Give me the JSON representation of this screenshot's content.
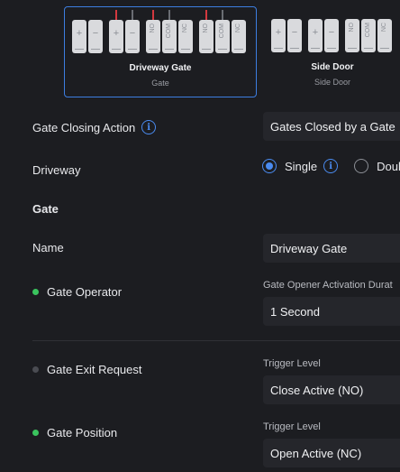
{
  "devices": [
    {
      "title": "Driveway Gate",
      "subtitle": "Gate",
      "selected": true,
      "terminals": [
        {
          "label": "+",
          "kind": "sym"
        },
        {
          "label": "−",
          "kind": "sym",
          "gap": true
        },
        {
          "label": "+",
          "kind": "sym",
          "wire": "red"
        },
        {
          "label": "−",
          "kind": "sym",
          "gap": true,
          "wire": "dark"
        },
        {
          "label": "NO",
          "kind": "text",
          "wire": "red"
        },
        {
          "label": "COM",
          "kind": "text",
          "wire": "dark"
        },
        {
          "label": "NC",
          "kind": "text",
          "gap": true
        },
        {
          "label": "NO",
          "kind": "text",
          "wire": "red"
        },
        {
          "label": "COM",
          "kind": "text",
          "wire": "dark"
        },
        {
          "label": "NC",
          "kind": "text"
        }
      ]
    },
    {
      "title": "Side Door",
      "subtitle": "Side Door",
      "selected": false,
      "terminals": [
        {
          "label": "+",
          "kind": "sym"
        },
        {
          "label": "−",
          "kind": "sym",
          "gap": true
        },
        {
          "label": "+",
          "kind": "sym"
        },
        {
          "label": "−",
          "kind": "sym",
          "gap": true
        },
        {
          "label": "NO",
          "kind": "text"
        },
        {
          "label": "COM",
          "kind": "text"
        },
        {
          "label": "NC",
          "kind": "text"
        }
      ]
    }
  ],
  "closing_action": {
    "label": "Gate Closing Action",
    "value": "Gates Closed by a Gate"
  },
  "driveway": {
    "label": "Driveway",
    "options": [
      "Single",
      "Doub"
    ],
    "selected": "Single"
  },
  "section_gate": "Gate",
  "name": {
    "label": "Name",
    "value": "Driveway Gate"
  },
  "gate_operator": {
    "label": "Gate Operator",
    "status_color": "#3ac45e",
    "field_label": "Gate Opener Activation Durat",
    "value": "1 Second"
  },
  "gate_exit_request": {
    "label": "Gate Exit Request",
    "status_color": "#4a4c52",
    "field_label": "Trigger Level",
    "value": "Close Active (NO)"
  },
  "gate_position": {
    "label": "Gate Position",
    "status_color": "#3ac45e",
    "field_label": "Trigger Level",
    "value": "Open Active (NC)"
  },
  "colors": {
    "accent": "#4a8bf0",
    "background": "#1c1d21",
    "field": "#25262b"
  }
}
